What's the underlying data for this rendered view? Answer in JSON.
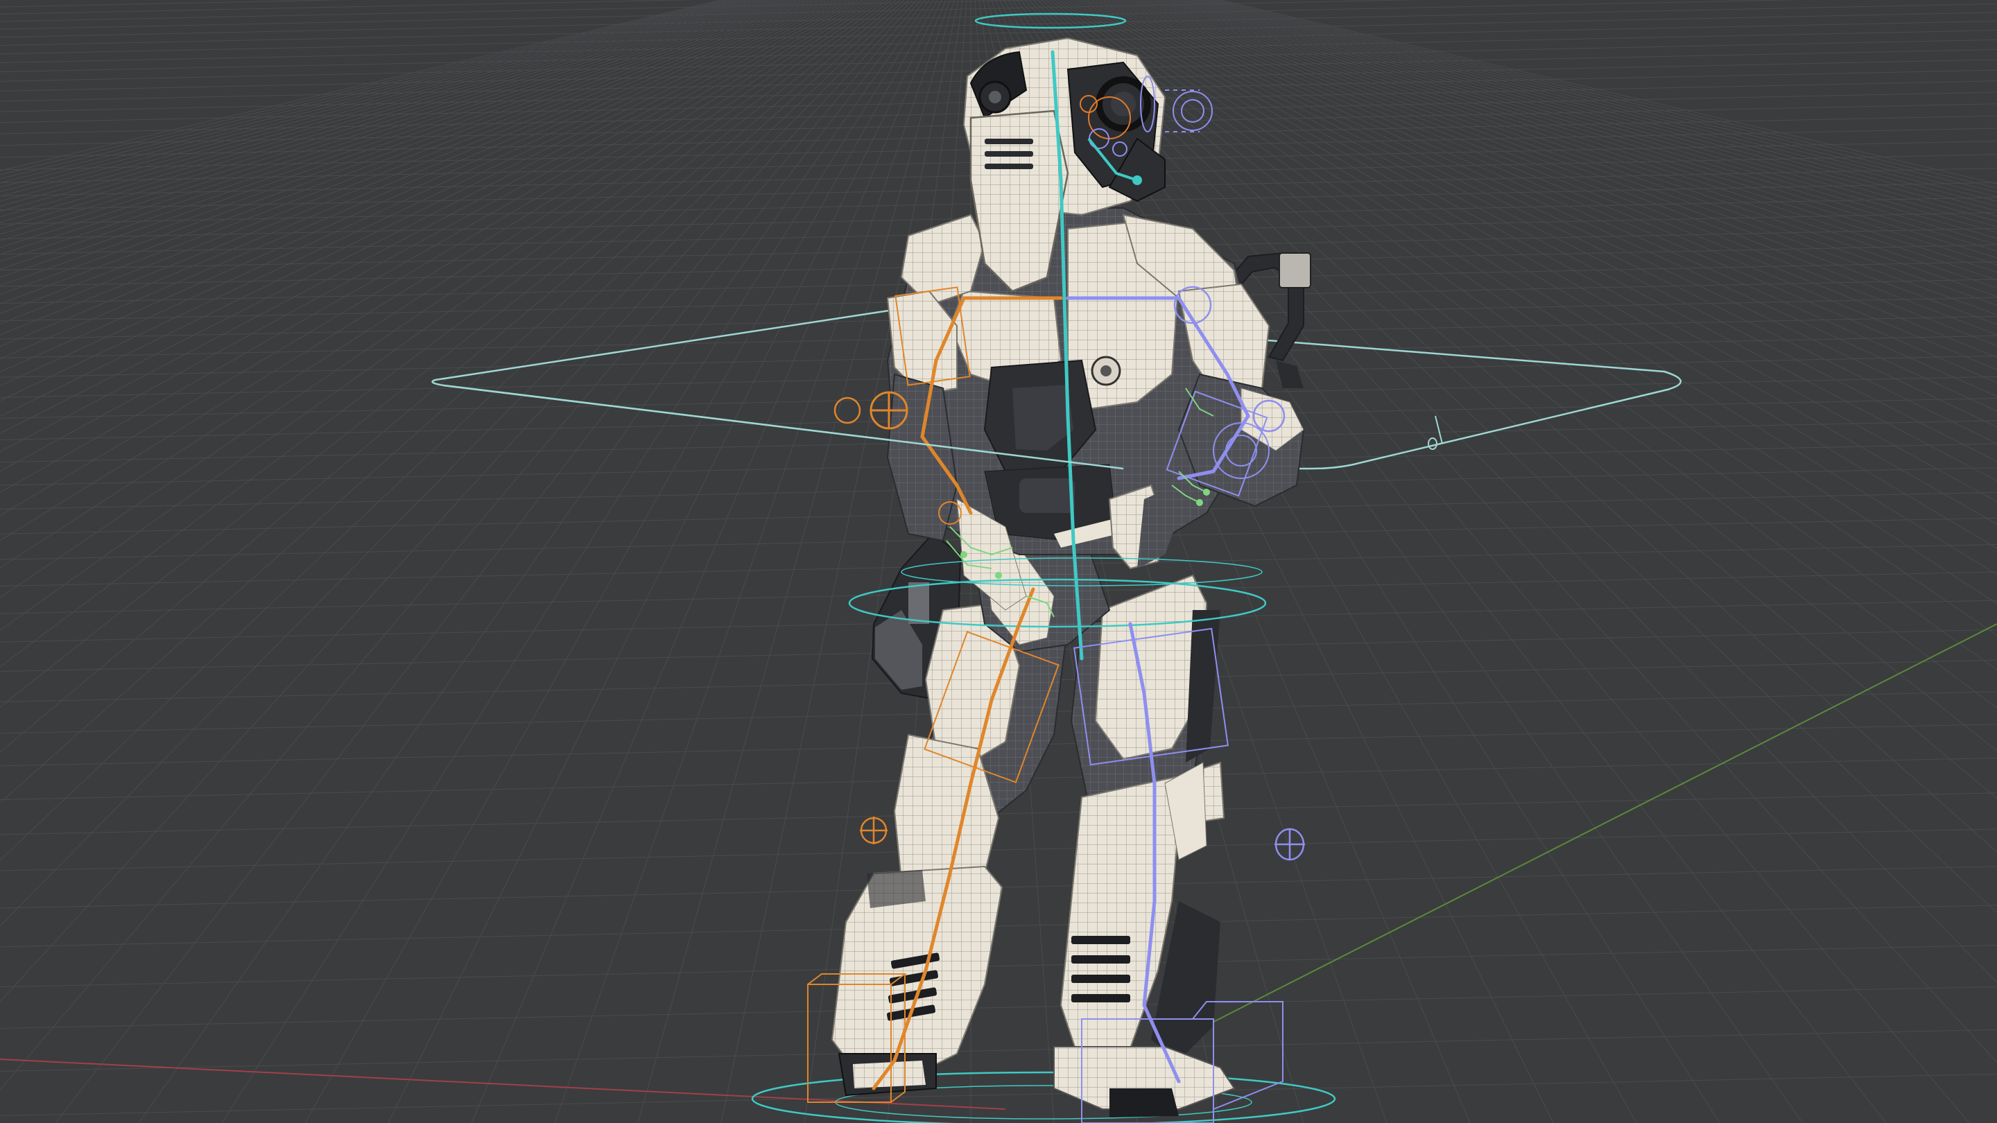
{
  "viewport": {
    "background": "#3b3c3e",
    "grid_color": "#4a4b4e",
    "x_axis_color": "#a0404a",
    "y_axis_color": "#5a8a3a"
  },
  "rig": {
    "main_controls_color": "#3fc9c4",
    "left_side_color": "#e0862b",
    "right_side_color": "#8f8ff0",
    "face_controls_color": "#e07a2a",
    "hand_controls_color": "#7fd67f"
  },
  "character": {
    "armor_color": "#e8e3d6",
    "undersuit_color": "#4c4d52",
    "dark_parts_color": "#2b2c30",
    "wire_color": "#8a8a85"
  },
  "icons": [
    "cog-control-icon",
    "ring-control-icon",
    "crosshair-control-icon"
  ]
}
